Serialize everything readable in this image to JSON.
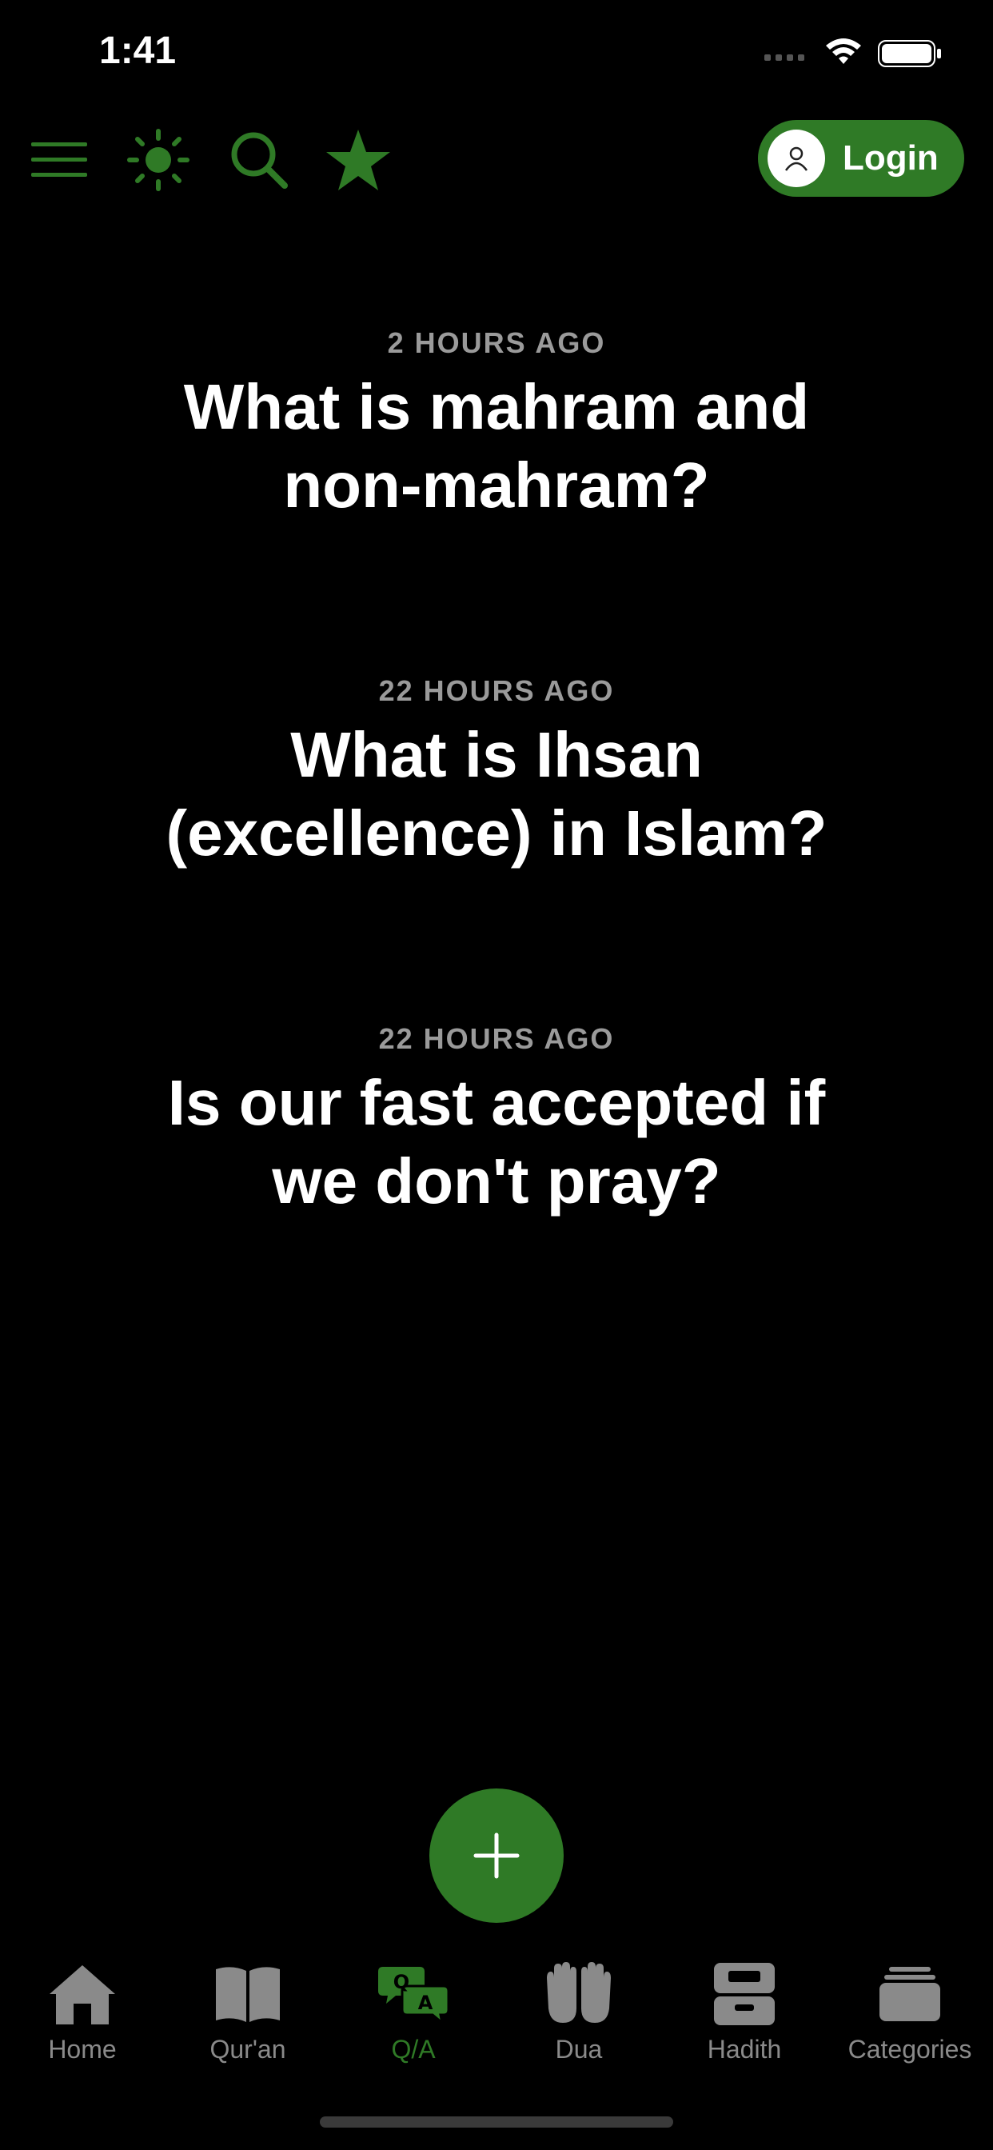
{
  "status_bar": {
    "time": "1:41"
  },
  "toolbar": {
    "icons": [
      "menu-icon",
      "sun-icon",
      "search-icon",
      "star-icon"
    ],
    "login_label": "Login"
  },
  "questions": [
    {
      "time": "2 HOURS AGO",
      "title": "What is mahram and non-mahram?"
    },
    {
      "time": "22 HOURS AGO",
      "title": "What is Ihsan (excellence) in Islam?"
    },
    {
      "time": "22 HOURS AGO",
      "title": "Is our fast accepted if we don't pray?"
    }
  ],
  "tabs": [
    {
      "label": "Home",
      "icon": "home-icon"
    },
    {
      "label": "Qur'an",
      "icon": "book-icon"
    },
    {
      "label": "Q/A",
      "icon": "qa-bubbles-icon",
      "active": true
    },
    {
      "label": "Dua",
      "icon": "praying-hands-icon"
    },
    {
      "label": "Hadith",
      "icon": "archive-icon"
    },
    {
      "label": "Categories",
      "icon": "stack-icon"
    }
  ],
  "colors": {
    "accent": "#2f7a26",
    "background": "#000000",
    "muted": "#8a8a8a"
  }
}
